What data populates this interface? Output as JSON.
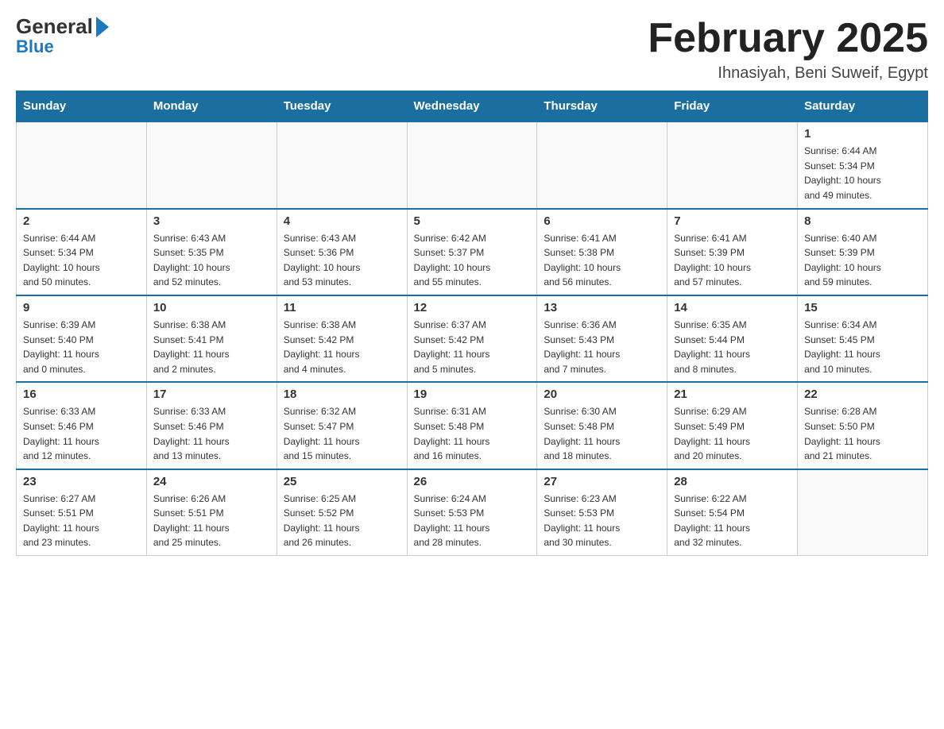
{
  "header": {
    "logo_general": "General",
    "logo_blue": "Blue",
    "month_title": "February 2025",
    "location": "Ihnasiyah, Beni Suweif, Egypt"
  },
  "weekdays": [
    "Sunday",
    "Monday",
    "Tuesday",
    "Wednesday",
    "Thursday",
    "Friday",
    "Saturday"
  ],
  "weeks": [
    [
      {
        "day": "",
        "info": ""
      },
      {
        "day": "",
        "info": ""
      },
      {
        "day": "",
        "info": ""
      },
      {
        "day": "",
        "info": ""
      },
      {
        "day": "",
        "info": ""
      },
      {
        "day": "",
        "info": ""
      },
      {
        "day": "1",
        "info": "Sunrise: 6:44 AM\nSunset: 5:34 PM\nDaylight: 10 hours\nand 49 minutes."
      }
    ],
    [
      {
        "day": "2",
        "info": "Sunrise: 6:44 AM\nSunset: 5:34 PM\nDaylight: 10 hours\nand 50 minutes."
      },
      {
        "day": "3",
        "info": "Sunrise: 6:43 AM\nSunset: 5:35 PM\nDaylight: 10 hours\nand 52 minutes."
      },
      {
        "day": "4",
        "info": "Sunrise: 6:43 AM\nSunset: 5:36 PM\nDaylight: 10 hours\nand 53 minutes."
      },
      {
        "day": "5",
        "info": "Sunrise: 6:42 AM\nSunset: 5:37 PM\nDaylight: 10 hours\nand 55 minutes."
      },
      {
        "day": "6",
        "info": "Sunrise: 6:41 AM\nSunset: 5:38 PM\nDaylight: 10 hours\nand 56 minutes."
      },
      {
        "day": "7",
        "info": "Sunrise: 6:41 AM\nSunset: 5:39 PM\nDaylight: 10 hours\nand 57 minutes."
      },
      {
        "day": "8",
        "info": "Sunrise: 6:40 AM\nSunset: 5:39 PM\nDaylight: 10 hours\nand 59 minutes."
      }
    ],
    [
      {
        "day": "9",
        "info": "Sunrise: 6:39 AM\nSunset: 5:40 PM\nDaylight: 11 hours\nand 0 minutes."
      },
      {
        "day": "10",
        "info": "Sunrise: 6:38 AM\nSunset: 5:41 PM\nDaylight: 11 hours\nand 2 minutes."
      },
      {
        "day": "11",
        "info": "Sunrise: 6:38 AM\nSunset: 5:42 PM\nDaylight: 11 hours\nand 4 minutes."
      },
      {
        "day": "12",
        "info": "Sunrise: 6:37 AM\nSunset: 5:42 PM\nDaylight: 11 hours\nand 5 minutes."
      },
      {
        "day": "13",
        "info": "Sunrise: 6:36 AM\nSunset: 5:43 PM\nDaylight: 11 hours\nand 7 minutes."
      },
      {
        "day": "14",
        "info": "Sunrise: 6:35 AM\nSunset: 5:44 PM\nDaylight: 11 hours\nand 8 minutes."
      },
      {
        "day": "15",
        "info": "Sunrise: 6:34 AM\nSunset: 5:45 PM\nDaylight: 11 hours\nand 10 minutes."
      }
    ],
    [
      {
        "day": "16",
        "info": "Sunrise: 6:33 AM\nSunset: 5:46 PM\nDaylight: 11 hours\nand 12 minutes."
      },
      {
        "day": "17",
        "info": "Sunrise: 6:33 AM\nSunset: 5:46 PM\nDaylight: 11 hours\nand 13 minutes."
      },
      {
        "day": "18",
        "info": "Sunrise: 6:32 AM\nSunset: 5:47 PM\nDaylight: 11 hours\nand 15 minutes."
      },
      {
        "day": "19",
        "info": "Sunrise: 6:31 AM\nSunset: 5:48 PM\nDaylight: 11 hours\nand 16 minutes."
      },
      {
        "day": "20",
        "info": "Sunrise: 6:30 AM\nSunset: 5:48 PM\nDaylight: 11 hours\nand 18 minutes."
      },
      {
        "day": "21",
        "info": "Sunrise: 6:29 AM\nSunset: 5:49 PM\nDaylight: 11 hours\nand 20 minutes."
      },
      {
        "day": "22",
        "info": "Sunrise: 6:28 AM\nSunset: 5:50 PM\nDaylight: 11 hours\nand 21 minutes."
      }
    ],
    [
      {
        "day": "23",
        "info": "Sunrise: 6:27 AM\nSunset: 5:51 PM\nDaylight: 11 hours\nand 23 minutes."
      },
      {
        "day": "24",
        "info": "Sunrise: 6:26 AM\nSunset: 5:51 PM\nDaylight: 11 hours\nand 25 minutes."
      },
      {
        "day": "25",
        "info": "Sunrise: 6:25 AM\nSunset: 5:52 PM\nDaylight: 11 hours\nand 26 minutes."
      },
      {
        "day": "26",
        "info": "Sunrise: 6:24 AM\nSunset: 5:53 PM\nDaylight: 11 hours\nand 28 minutes."
      },
      {
        "day": "27",
        "info": "Sunrise: 6:23 AM\nSunset: 5:53 PM\nDaylight: 11 hours\nand 30 minutes."
      },
      {
        "day": "28",
        "info": "Sunrise: 6:22 AM\nSunset: 5:54 PM\nDaylight: 11 hours\nand 32 minutes."
      },
      {
        "day": "",
        "info": ""
      }
    ]
  ]
}
